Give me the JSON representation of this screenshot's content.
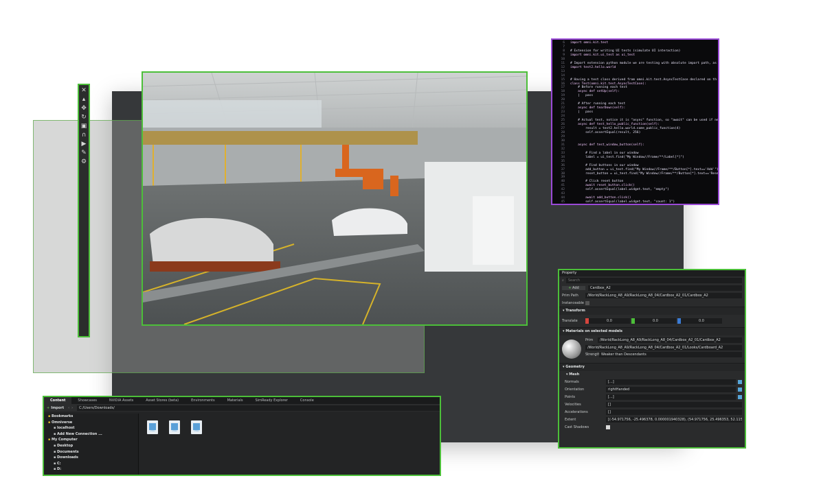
{
  "toolbar": {
    "icons": [
      "select-icon",
      "pointer-icon",
      "move-icon",
      "rotate-icon",
      "scale-icon",
      "snap-icon",
      "play-icon",
      "paint-icon",
      "settings-icon"
    ]
  },
  "code": {
    "lines": [
      {
        "n": "6",
        "t": "import omni.kit.test"
      },
      {
        "n": "7",
        "t": ""
      },
      {
        "n": "8",
        "t": "# Extension for writing UI tests (simulate UI interaction)"
      },
      {
        "n": "9",
        "t": "import omni.kit.ui_test as ui_test"
      },
      {
        "n": "10",
        "t": ""
      },
      {
        "n": "11",
        "t": "# Import extension python module we are testing with absolute import path, as"
      },
      {
        "n": "12",
        "t": "import test2.hello.world"
      },
      {
        "n": "13",
        "t": ""
      },
      {
        "n": "14",
        "t": ""
      },
      {
        "n": "15",
        "t": "# Having a test class derived from omni.kit.test.AsyncTestCase declared on th"
      },
      {
        "n": "16",
        "t": "class Test(omni.kit.test.AsyncTestCase):"
      },
      {
        "n": "17",
        "t": "    # Before running each test"
      },
      {
        "n": "18",
        "t": "    async def setUp(self):"
      },
      {
        "n": "19",
        "t": "    |   pass"
      },
      {
        "n": "20",
        "t": ""
      },
      {
        "n": "21",
        "t": "    # After running each test"
      },
      {
        "n": "22",
        "t": "    async def tearDown(self):"
      },
      {
        "n": "23",
        "t": "    |   pass"
      },
      {
        "n": "24",
        "t": ""
      },
      {
        "n": "25",
        "t": "    # Actual test, notice it is \"async\" function, so \"await\" can be used if ne"
      },
      {
        "n": "26",
        "t": "    async def test_hello_public_function(self):"
      },
      {
        "n": "27",
        "t": "        result = test2.hello.world.some_public_function(4)"
      },
      {
        "n": "28",
        "t": "        self.assertEqual(result, 256)"
      },
      {
        "n": "29",
        "t": ""
      },
      {
        "n": "30",
        "t": ""
      },
      {
        "n": "31",
        "t": "    async def test_window_button(self):"
      },
      {
        "n": "32",
        "t": ""
      },
      {
        "n": "33",
        "t": "        # Find a label in our window"
      },
      {
        "n": "34",
        "t": "        label = ui_test.find(\"My Window//Frame/**/Label[*]\")"
      },
      {
        "n": "35",
        "t": ""
      },
      {
        "n": "36",
        "t": "        # Find buttons in our window"
      },
      {
        "n": "37",
        "t": "        add_button = ui_test.find(\"My Window//Frame/**/Button[*].text=='Add'\")"
      },
      {
        "n": "38",
        "t": "        reset_button = ui_test.find(\"My Window//Frame/**/Button[*].text=='Rese"
      },
      {
        "n": "39",
        "t": ""
      },
      {
        "n": "40",
        "t": "        # Click reset button"
      },
      {
        "n": "41",
        "t": "        await reset_button.click()"
      },
      {
        "n": "42",
        "t": "        self.assertEqual(label.widget.text, \"empty\")"
      },
      {
        "n": "43",
        "t": ""
      },
      {
        "n": "44",
        "t": "        await add_button.click()"
      },
      {
        "n": "45",
        "t": "        self.assertEqual(label.widget.text, \"count: 1\")"
      }
    ]
  },
  "property": {
    "title": "Property",
    "search_placeholder": "Search",
    "add_label": "Add",
    "name_value": "Cardbox_A2",
    "prim_path_label": "Prim Path",
    "prim_path_value": "/World/RackLong_A8_A9/RackLong_A8_04/Cardbox_A2_01/Cardbox_A2",
    "instanceable_label": "Instanceable",
    "transform_title": "Transform",
    "translate_label": "Translate",
    "translate": {
      "x": "0.0",
      "y": "0.0",
      "z": "0.0"
    },
    "materials_title": "Materials on selected models",
    "prim_label": "Prim",
    "material_prim": "/World/RackLong_A8_A9/RackLong_A8_04/Cardbox_A2_01/Cardbox_A2",
    "material_path": "/World/RackLong_A8_A9/RackLong_A8_04/Cardbox_A2_01/Looks/Cardboard_A2",
    "strength_label": "Strength",
    "strength_value": "Weaker than Descendants",
    "geometry_title": "Geometry",
    "mesh_title": "Mesh",
    "normals_label": "Normals",
    "normals_value": "[...]",
    "orientation_label": "Orientation",
    "orientation_value": "rightHanded",
    "points_label": "Points",
    "points_value": "[...]",
    "velocities_label": "Velocities",
    "velocities_value": "[]",
    "accelerations_label": "Accelerations",
    "accelerations_value": "[]",
    "extent_label": "Extent",
    "extent_value": "[(-54.971756, -25.496378, 0.000001940328), (54.971756, 25.496353, 52.115171)]",
    "cast_shadows_label": "Cast Shadows"
  },
  "content": {
    "tabs": [
      "Content",
      "Showcases",
      "NVIDIA Assets",
      "Asset Stores (beta)",
      "Environments",
      "Materials",
      "SimReady Explorer",
      "Console"
    ],
    "import_label": "Import",
    "path_value": "C:/Users/Downloads/",
    "tree": [
      {
        "label": "Bookmarks",
        "indent": 0,
        "bold": true
      },
      {
        "label": "Omniverse",
        "indent": 0,
        "bold": true
      },
      {
        "label": "localhost",
        "indent": 1,
        "bold": true
      },
      {
        "label": "Add New Connection ...",
        "indent": 1,
        "bold": true
      },
      {
        "label": "My Computer",
        "indent": 0,
        "bold": true
      },
      {
        "label": "Desktop",
        "indent": 1,
        "bold": true
      },
      {
        "label": "Documents",
        "indent": 1,
        "bold": true
      },
      {
        "label": "Downloads",
        "indent": 1,
        "bold": true
      },
      {
        "label": "C:",
        "indent": 1,
        "bold": true
      },
      {
        "label": "D:",
        "indent": 1,
        "bold": true
      }
    ],
    "files": [
      "USD",
      "USD",
      "USD"
    ]
  },
  "colors": {
    "accent_green": "#4cbf39",
    "code_border": "#9b4ad8",
    "panel_bg": "#2a2b2c"
  }
}
